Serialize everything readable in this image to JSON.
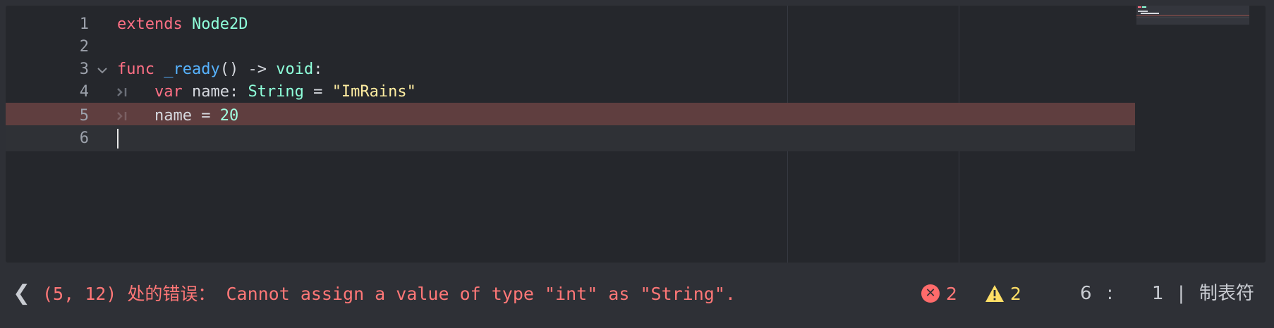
{
  "editor": {
    "lines": [
      {
        "number": "1",
        "tokens": [
          {
            "t": "extends",
            "c": "kw"
          },
          {
            "t": " ",
            "c": "plain"
          },
          {
            "t": "Node2D",
            "c": "type"
          }
        ]
      },
      {
        "number": "2",
        "tokens": []
      },
      {
        "number": "3",
        "tokens": [
          {
            "t": "func",
            "c": "kw"
          },
          {
            "t": " ",
            "c": "plain"
          },
          {
            "t": "_ready",
            "c": "fn"
          },
          {
            "t": "() -> ",
            "c": "plain"
          },
          {
            "t": "void",
            "c": "type"
          },
          {
            "t": ":",
            "c": "plain"
          }
        ]
      },
      {
        "number": "4",
        "tokens": [
          {
            "t": "    ",
            "c": "plain"
          },
          {
            "t": "var",
            "c": "kw"
          },
          {
            "t": " name: ",
            "c": "plain"
          },
          {
            "t": "String",
            "c": "type"
          },
          {
            "t": " = ",
            "c": "plain"
          },
          {
            "t": "\"ImRains\"",
            "c": "str"
          }
        ]
      },
      {
        "number": "5",
        "tokens": [
          {
            "t": "    name = ",
            "c": "plain"
          },
          {
            "t": "20",
            "c": "num"
          }
        ]
      },
      {
        "number": "6",
        "tokens": []
      }
    ],
    "fold_icon": "chevron-down-icon",
    "tab_marker": "tab-indent-icon"
  },
  "status": {
    "nav_arrow": "❮",
    "error_message": "(5, 12) 处的错误： Cannot assign a value of type \"int\" as \"String\".",
    "error_count": "2",
    "warning_count": "2",
    "line": "6",
    "separator": ":",
    "column": "1",
    "divider": "|",
    "indent_mode": "制表符"
  },
  "colors": {
    "keyword": "#ff7085",
    "type": "#8effda",
    "function": "#57b3ff",
    "string": "#ffeda1",
    "number": "#a1ffe0",
    "error": "#ff7777",
    "warning": "#ffde66",
    "error_line_bg": "#5f3e3f"
  }
}
